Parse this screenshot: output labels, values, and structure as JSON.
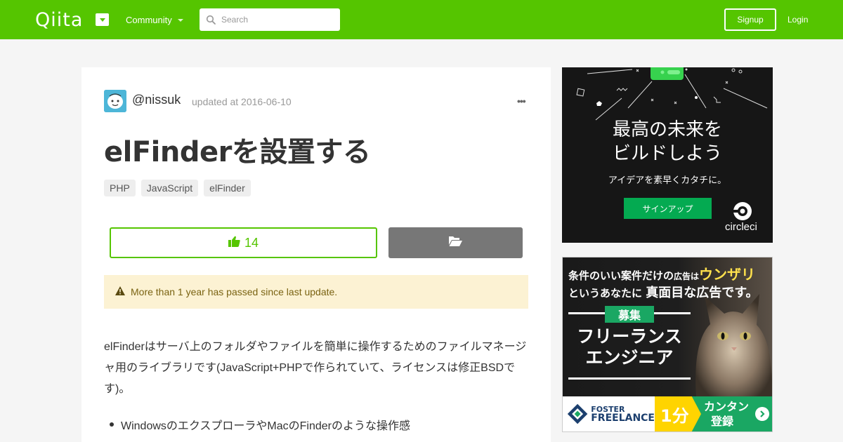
{
  "header": {
    "logo": "Qiita",
    "community_label": "Community",
    "search_placeholder": "Search",
    "signup_label": "Signup",
    "login_label": "Login"
  },
  "article": {
    "author": "@nissuk",
    "updated": "updated at 2016-06-10",
    "more_menu": "•••",
    "title": "elFinderを設置する",
    "tags": [
      "PHP",
      "JavaScript",
      "elFinder"
    ],
    "likes": "14",
    "alert": "More than 1 year has passed since last update.",
    "body": "elFinderはサーバ上のフォルダやファイルを簡単に操作するためのファイルマネージャ用のライブラリです(JavaScript+PHPで作られていて、ライセンスは修正BSDです)。",
    "bullets": [
      "WindowsのエクスプローラやMacのFinderのような操作感"
    ]
  },
  "ads": {
    "circleci": {
      "headline_1": "最高の未来を",
      "headline_2": "ビルドしよう",
      "sub": "アイデアを素早くカタチに。",
      "button": "サインアップ",
      "brand": "circleci"
    },
    "foster": {
      "line1_a": "条件のいい案件だけの",
      "line1_b": "広告は",
      "line1_c": "ウンザリ",
      "line2_a": "というあなたに",
      "line2_b": "真面目な広告です。",
      "badge": "募集",
      "title_1": "フリーランス",
      "title_2": "エンジニア",
      "brand_1": "FOSTER",
      "brand_2": "FREELANCE",
      "cta_big": "1分",
      "cta_1": "カンタン",
      "cta_2": "登録"
    }
  },
  "colors": {
    "brand_green": "#55c500",
    "alert_bg": "#fcf2d3",
    "ad_green": "#04aa51"
  }
}
